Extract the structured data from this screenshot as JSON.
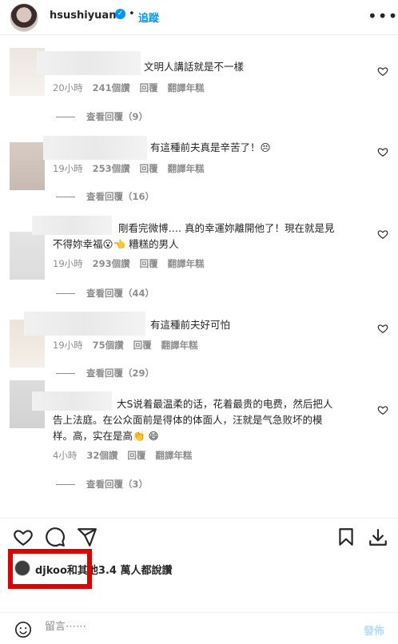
{
  "header": {
    "username": "hsushiyuan",
    "separator": "•",
    "follow_label": "追蹤",
    "verified_mark": "✓",
    "more_label": "•••"
  },
  "comments": [
    {
      "text": "文明人講話就是不一樣",
      "time": "20小時",
      "likes": "241個讚",
      "reply": "回覆",
      "translate": "翻譯年糕",
      "view_replies": "查看回覆（9）"
    },
    {
      "text": "有這種前夫真是辛苦了！😣",
      "time": "19小時",
      "likes": "253個讚",
      "reply": "回覆",
      "translate": "翻譯年糕",
      "view_replies": "查看回覆（16）"
    },
    {
      "text_line1": "剛看完微博…. 真的幸運妳離開他了！現在就是見",
      "text_line2": "不得妳幸福😮👈 糟糕的男人",
      "time": "19小時",
      "likes": "293個讚",
      "reply": "回覆",
      "translate": "翻譯年糕",
      "view_replies": "查看回覆（44）"
    },
    {
      "text": "有這種前夫好可怕",
      "time": "19小時",
      "likes": "75個讚",
      "reply": "回覆",
      "translate": "翻譯年糕",
      "view_replies": "查看回覆（29）"
    },
    {
      "text_line1": "大S说着最温柔的话，花着最贵的电费，然后把人",
      "text_line2": "告上法庭。在公众面前是得体的体面人，汪就是气急败坏的模",
      "text_line3": "样。高，实在是高👏 😄",
      "time": "4小時",
      "likes": "32個讚",
      "reply": "回覆",
      "translate": "翻譯年糕",
      "view_replies": "查看回覆（3）"
    }
  ],
  "likes_summary": "djkoo和其他3.4 萬人都說讚",
  "comment_box": {
    "placeholder": "留言⋯⋯",
    "post_label": "發佈"
  },
  "colors": {
    "accent": "#0095f6",
    "highlight_box": "#e00000",
    "muted_text": "#8e8e8e"
  }
}
